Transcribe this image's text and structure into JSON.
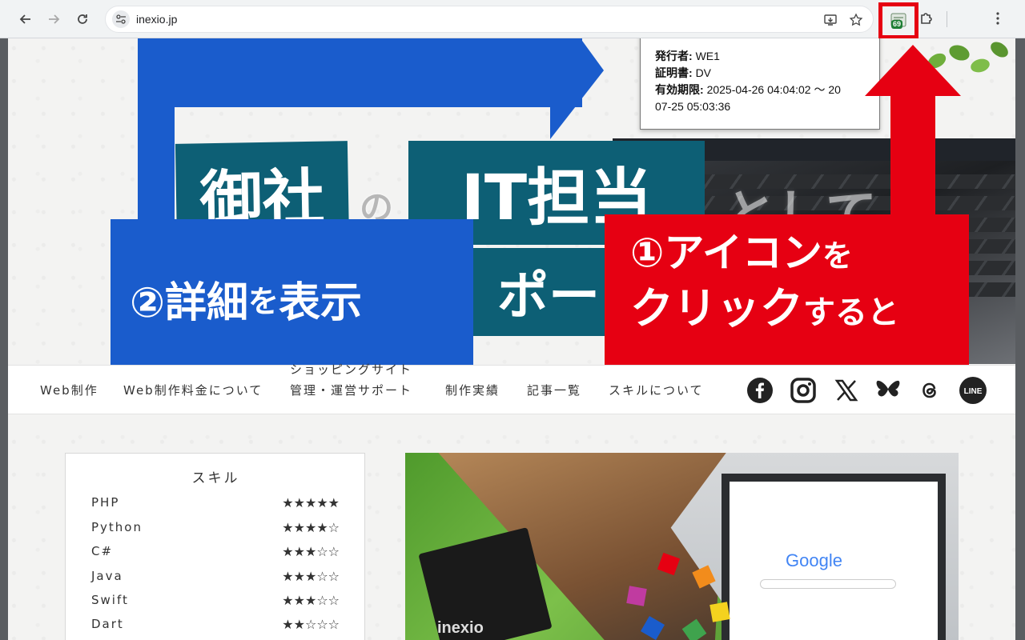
{
  "browser": {
    "url": "inexio.jp",
    "extension_badge": "69"
  },
  "tooltip": {
    "issuer_label": "発行者:",
    "issuer_value": "WE1",
    "cert_label": "証明書:",
    "cert_value": "DV",
    "validity_label": "有効期限:",
    "validity_value_line1": "2025-04-26 04:04:02 ～ 20",
    "validity_value_line2": "07-25 05:03:36"
  },
  "hero": {
    "title_part1": "御社",
    "title_no": "の",
    "title_part2": "IT担当",
    "title_part3": "として",
    "title_part4": "ポー"
  },
  "callouts": {
    "red_line1_big": "①アイコン",
    "red_line1_small": "を",
    "red_line2_big": "クリック",
    "red_line2_small": "すると",
    "blue_big1": "②詳細",
    "blue_small": "を",
    "blue_big2": "表示"
  },
  "nav": {
    "items": [
      "Web制作",
      "Web制作料金について",
      "ショッピングサイト",
      "管理・運営サポート",
      "制作実績",
      "記事一覧",
      "スキルについて"
    ],
    "social_icons": [
      "facebook-icon",
      "instagram-icon",
      "x-icon",
      "bluesky-icon",
      "threads-icon",
      "line-icon"
    ],
    "line_label": "LINE"
  },
  "skills": {
    "title": "スキル",
    "rows": [
      {
        "name": "PHP",
        "stars": "★★★★★",
        "rating": 5
      },
      {
        "name": "Python",
        "stars": "★★★★☆",
        "rating": 4
      },
      {
        "name": "C#",
        "stars": "★★★☆☆",
        "rating": 3
      },
      {
        "name": "Java",
        "stars": "★★★☆☆",
        "rating": 3
      },
      {
        "name": "Swift",
        "stars": "★★★☆☆",
        "rating": 3
      },
      {
        "name": "Dart",
        "stars": "★★☆☆☆",
        "rating": 2
      }
    ]
  },
  "collage": {
    "google_text": "Google",
    "notebook_brand": "inexio"
  },
  "colors": {
    "red_accent": "#e60012",
    "blue_accent": "#1a5ccc",
    "teal_title": "#0d5f75"
  }
}
